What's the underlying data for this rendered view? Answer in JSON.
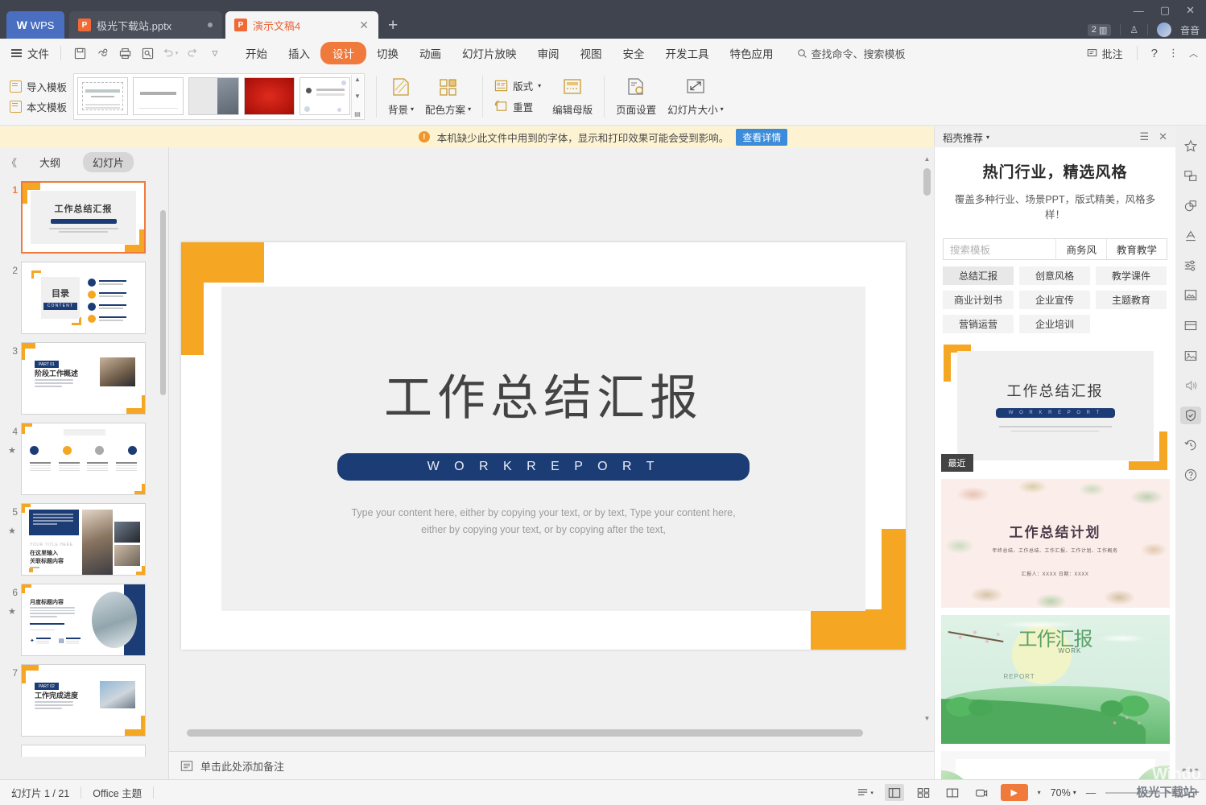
{
  "titlebar": {
    "app_badge": "WPS",
    "tabs": [
      {
        "label": "极光下载站.pptx",
        "icon": "pptx-file-icon",
        "active": false
      },
      {
        "label": "演示文稿4",
        "icon": "pptx-file-icon",
        "active": true
      }
    ],
    "new_tab": "+",
    "doc_count": "2",
    "user_name": "音音",
    "window_minimize": "—",
    "window_maximize": "▢",
    "window_close": "✕"
  },
  "menubar": {
    "file": "文件",
    "quick_access": [
      "save-icon",
      "cloud-sync-icon",
      "print-icon",
      "print-preview-icon",
      "undo-icon",
      "redo-icon",
      "customize-qat-icon"
    ],
    "items": [
      {
        "label": "开始",
        "active": false
      },
      {
        "label": "插入",
        "active": false
      },
      {
        "label": "设计",
        "active": true
      },
      {
        "label": "切换",
        "active": false
      },
      {
        "label": "动画",
        "active": false
      },
      {
        "label": "幻灯片放映",
        "active": false
      },
      {
        "label": "审阅",
        "active": false
      },
      {
        "label": "视图",
        "active": false
      },
      {
        "label": "安全",
        "active": false
      },
      {
        "label": "开发工具",
        "active": false
      },
      {
        "label": "特色应用",
        "active": false
      }
    ],
    "search_placeholder": "查找命令、搜索模板",
    "comment": "批注",
    "help": "?",
    "more": "⋮",
    "collapse": "︿"
  },
  "ribbon": {
    "import_template": "导入模板",
    "this_template": "本文模板",
    "background": "背景",
    "color_scheme": "配色方案",
    "layout": "版式",
    "reset": "重置",
    "edit_master": "编辑母版",
    "page_setup": "页面设置",
    "slide_size": "幻灯片大小"
  },
  "notice": {
    "text": "本机缺少此文件中用到的字体，显示和打印效果可能会受到影响。",
    "button": "查看详情",
    "close": "✕"
  },
  "left_panel": {
    "collapse": "《",
    "tab_outline": "大纲",
    "tab_slides": "幻灯片",
    "slides": [
      {
        "num": "1",
        "selected": true,
        "starred": false,
        "kind": "title"
      },
      {
        "num": "2",
        "selected": false,
        "starred": false,
        "kind": "toc",
        "label": "目录",
        "label_sub": "CONTENT"
      },
      {
        "num": "3",
        "selected": false,
        "starred": false,
        "kind": "part",
        "tag": "PART 01",
        "title": "阶段工作概述"
      },
      {
        "num": "4",
        "selected": false,
        "starred": true,
        "kind": "four"
      },
      {
        "num": "5",
        "selected": false,
        "starred": true,
        "kind": "photos",
        "title": "在这里输入",
        "title2": "关联标题内容",
        "eyebrow": "YOUR TITLE HERE"
      },
      {
        "num": "6",
        "selected": false,
        "starred": true,
        "kind": "round",
        "title": "月度标题内容"
      },
      {
        "num": "7",
        "selected": false,
        "starred": false,
        "kind": "part",
        "tag": "PART 02",
        "title": "工作完成进度"
      }
    ]
  },
  "slide": {
    "title": "工作总结汇报",
    "ribbon_text": "W O R K     R E P O R T",
    "body_line1": "Type your content here, either by copying your text, or by text, Type your content here,",
    "body_line2": "either by copying your text, or by copying after the text,",
    "accent_yellow": "#f5a623",
    "accent_navy": "#1c3c75"
  },
  "notes": {
    "placeholder": "单击此处添加备注",
    "icon": "notes-icon"
  },
  "right_panel": {
    "title": "稻壳推荐",
    "menu_icon": "list-menu-icon",
    "close_icon": "close-icon",
    "headline": "热门行业，精选风格",
    "subhead": "覆盖多种行业、场景PPT，版式精美，风格多样！",
    "search_placeholder": "搜索模板",
    "search_buttons": [
      "商务风",
      "教育教学"
    ],
    "chips": [
      {
        "label": "总结汇报",
        "selected": true
      },
      {
        "label": "创意风格",
        "selected": false
      },
      {
        "label": "教学课件",
        "selected": false
      },
      {
        "label": "商业计划书",
        "selected": false
      },
      {
        "label": "企业宣传",
        "selected": false
      },
      {
        "label": "主题教育",
        "selected": false
      },
      {
        "label": "营销运营",
        "selected": false
      },
      {
        "label": "企业培训",
        "selected": false
      }
    ],
    "cards": [
      {
        "kind": "work-report",
        "title": "工作总结汇报",
        "sub": "W O R K   R E P O R T",
        "badge": "最近"
      },
      {
        "kind": "floral-plan",
        "title": "工作总结计划",
        "sub": "年终总结、工作总结、工作汇报、工作计划、工作概务",
        "meta": "汇报人：XXXX        日期：XXXX"
      },
      {
        "kind": "green-spring",
        "title": "工作汇报",
        "en1": "WORK",
        "en2": "REPORT"
      },
      {
        "kind": "partial",
        "title": ""
      }
    ]
  },
  "rail": {
    "icons": [
      {
        "name": "star-effects-icon",
        "glyph": "✧",
        "active": false
      },
      {
        "name": "shapes-swap-icon",
        "glyph": "⧉",
        "active": false
      },
      {
        "name": "shape-combine-icon",
        "glyph": "◯",
        "active": false
      },
      {
        "name": "text-art-icon",
        "glyph": "A",
        "active": false
      },
      {
        "name": "adjust-sliders-icon",
        "glyph": "≡",
        "active": false
      },
      {
        "name": "picture-frame-icon",
        "glyph": "▤",
        "active": false
      },
      {
        "name": "box-icon",
        "glyph": "▭",
        "active": false
      },
      {
        "name": "image-icon",
        "glyph": "▣",
        "active": false
      },
      {
        "name": "audio-icon",
        "glyph": "◁",
        "active": false
      },
      {
        "name": "shield-check-icon",
        "glyph": "✓",
        "active": true
      },
      {
        "name": "history-icon",
        "glyph": "↺",
        "active": false
      },
      {
        "name": "help-circle-icon",
        "glyph": "?",
        "active": false
      },
      {
        "name": "more-dots-icon",
        "glyph": "···",
        "active": false
      }
    ]
  },
  "statusbar": {
    "slide_counter": "幻灯片 1 / 21",
    "theme": "Office 主题",
    "views": [
      {
        "name": "reading-list-icon",
        "active": false
      },
      {
        "name": "normal-view-icon",
        "active": true
      },
      {
        "name": "slide-sorter-icon",
        "active": false
      },
      {
        "name": "reading-view-icon",
        "active": false
      },
      {
        "name": "presenter-view-icon",
        "active": false
      }
    ],
    "play_label": "▶",
    "zoom": "70%",
    "zoom_out": "—",
    "zoom_in": "+"
  },
  "watermark": {
    "win": "Windo",
    "site": "极光下载站"
  }
}
